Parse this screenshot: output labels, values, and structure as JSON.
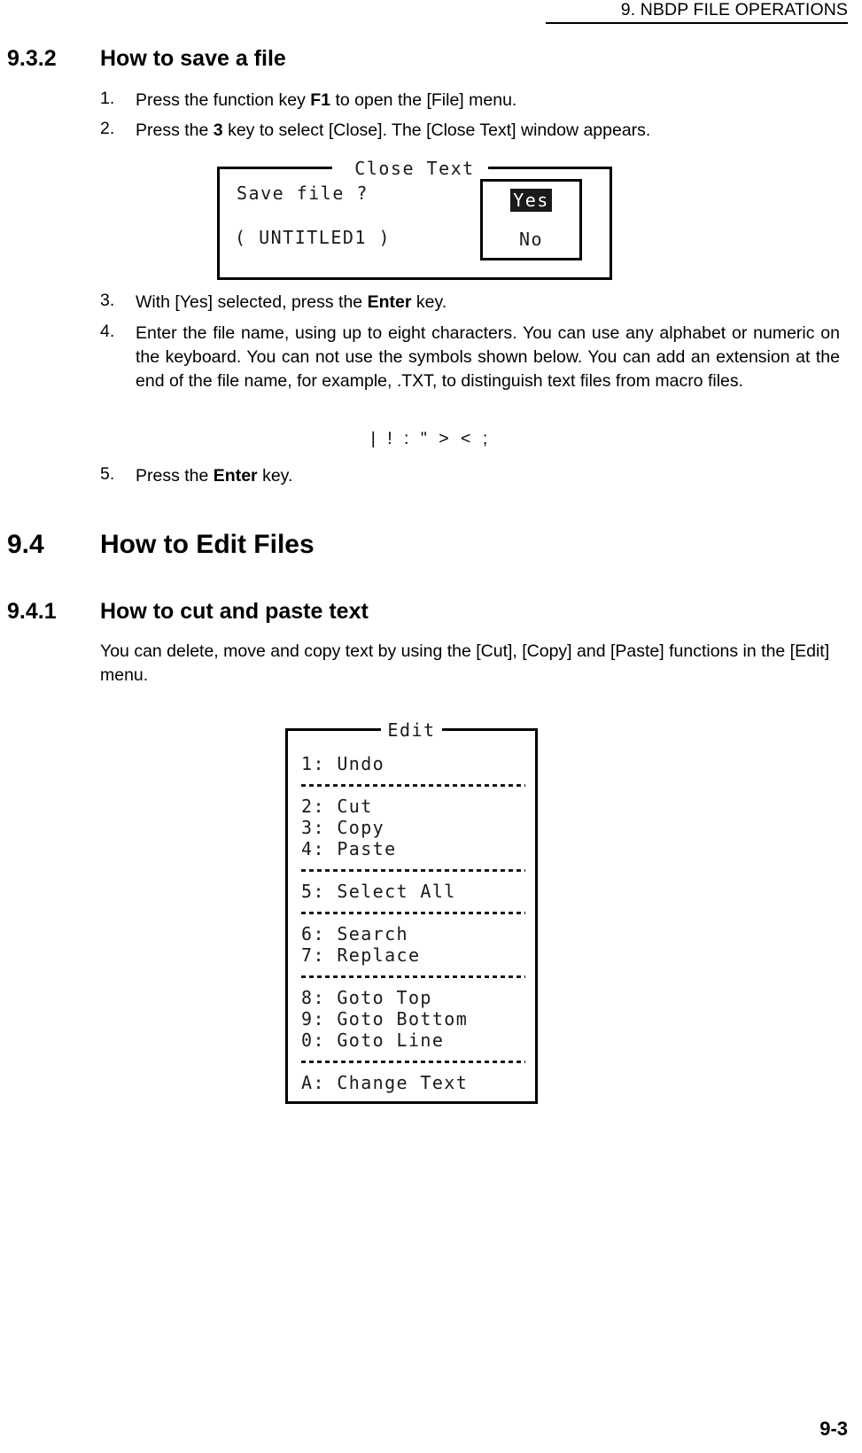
{
  "header": {
    "running_head": "9.  NBDP FILE OPERATIONS"
  },
  "footer": {
    "page_number": "9-3"
  },
  "sections": {
    "s932": {
      "number": "9.3.2",
      "title": "How to save a file"
    },
    "s94": {
      "number": "9.4",
      "title": "How to Edit Files"
    },
    "s941": {
      "number": "9.4.1",
      "title": "How to cut and paste text"
    }
  },
  "steps": {
    "n1": "1.",
    "n2": "2.",
    "n3": "3.",
    "n4": "4.",
    "n5": "5."
  },
  "body": {
    "step1_a": "Press the function key ",
    "step1_key": "F1",
    "step1_b": " to open the [File] menu.",
    "step2_a": "Press the ",
    "step2_key": "3",
    "step2_b": " key to select [Close]. The [Close Text] window appears.",
    "step3_a": "With [Yes] selected, press the ",
    "step3_key": "Enter",
    "step3_b": " key.",
    "step4": "Enter the file name, using up to eight characters. You can use any alphabet or numeric on the keyboard. You can not use the symbols shown below. You can add an extension at the end of the file name, for example, .TXT, to distinguish text files from macro files.",
    "forbidden_symbols": "| ! : \" > < ;",
    "step5_a": "Press the ",
    "step5_key": "Enter",
    "step5_b": " key.",
    "s941_intro": "You can delete, move and copy text by using the [Cut], [Copy] and [Paste] functions in the [Edit] menu."
  },
  "close_dialog": {
    "title": "Close Text",
    "prompt": "Save file ?",
    "filename_display": "( UNTITLED1   )",
    "filename_value": "UNTITLED1",
    "options": [
      {
        "label": "Yes",
        "selected": true
      },
      {
        "label": "No",
        "selected": false
      }
    ],
    "yes_label": "Yes",
    "no_label": "No"
  },
  "edit_menu": {
    "title": "Edit",
    "rows": [
      {
        "kind": "item",
        "label": "1: Undo"
      },
      {
        "kind": "sep"
      },
      {
        "kind": "item",
        "label": "2: Cut"
      },
      {
        "kind": "item",
        "label": "3: Copy"
      },
      {
        "kind": "item",
        "label": "4: Paste"
      },
      {
        "kind": "sep"
      },
      {
        "kind": "item",
        "label": "5: Select All"
      },
      {
        "kind": "sep"
      },
      {
        "kind": "item",
        "label": "6: Search"
      },
      {
        "kind": "item",
        "label": "7: Replace"
      },
      {
        "kind": "sep"
      },
      {
        "kind": "item",
        "label": "8: Goto Top"
      },
      {
        "kind": "item",
        "label": "9: Goto Bottom"
      },
      {
        "kind": "item",
        "label": "0: Goto Line"
      },
      {
        "kind": "sep"
      },
      {
        "kind": "item",
        "label": "A: Change Text"
      }
    ]
  },
  "colors": {
    "ink": "#000000",
    "lcd_ink": "#1a1a1a",
    "paper": "#ffffff",
    "highlight_bg": "#1a1a1a",
    "highlight_fg": "#ffffff"
  }
}
